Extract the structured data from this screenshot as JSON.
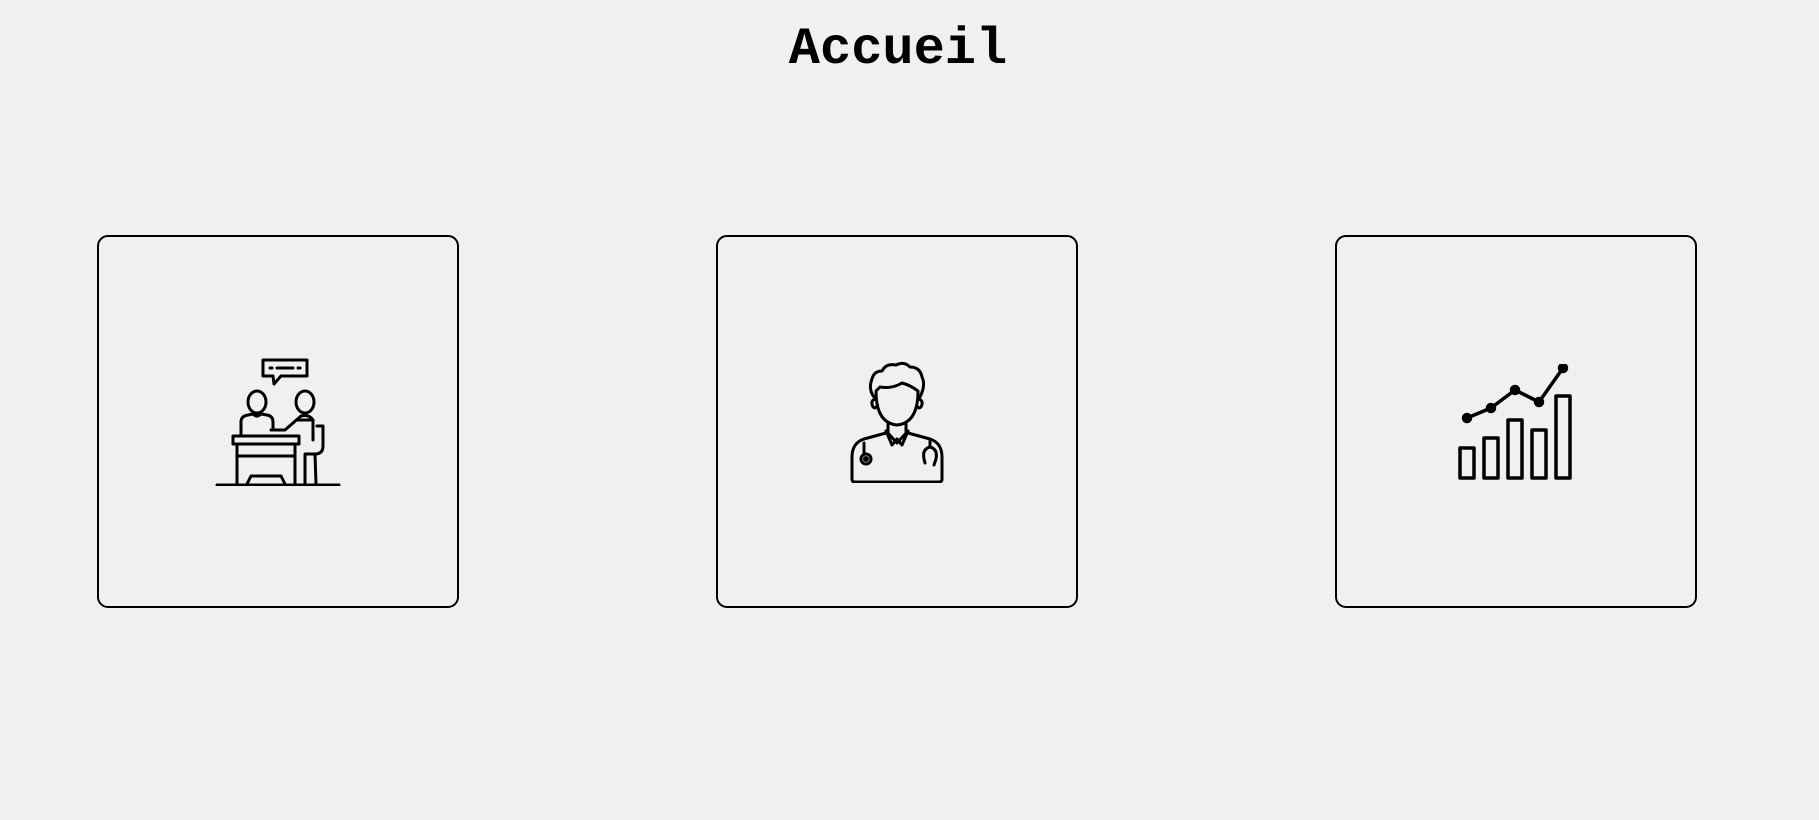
{
  "page": {
    "title": "Accueil"
  },
  "cards": [
    {
      "icon": "consultation-icon"
    },
    {
      "icon": "doctor-icon"
    },
    {
      "icon": "statistics-chart-icon"
    }
  ]
}
